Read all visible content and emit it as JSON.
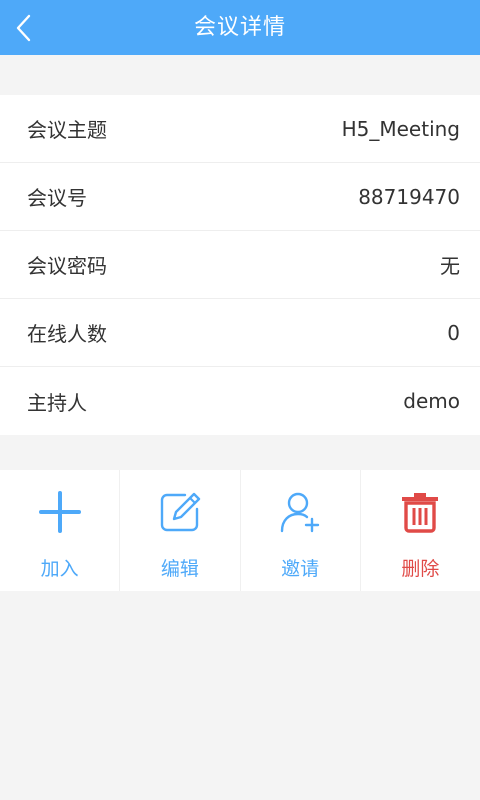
{
  "header": {
    "title": "会议详情",
    "back_icon": "chevron-left-icon",
    "background": "#4ea9f9"
  },
  "details": [
    {
      "label": "会议主题",
      "value": "H5_Meeting"
    },
    {
      "label": "会议号",
      "value": "88719470"
    },
    {
      "label": "会议密码",
      "value": "无"
    },
    {
      "label": "在线人数",
      "value": "0"
    },
    {
      "label": "主持人",
      "value": "demo"
    }
  ],
  "actions": [
    {
      "label": "加入",
      "icon": "plus-icon",
      "color": "#4ea9f9"
    },
    {
      "label": "编辑",
      "icon": "edit-icon",
      "color": "#4ea9f9"
    },
    {
      "label": "邀请",
      "icon": "add-user-icon",
      "color": "#4ea9f9"
    },
    {
      "label": "删除",
      "icon": "trash-icon",
      "color": "#e04a47"
    }
  ]
}
